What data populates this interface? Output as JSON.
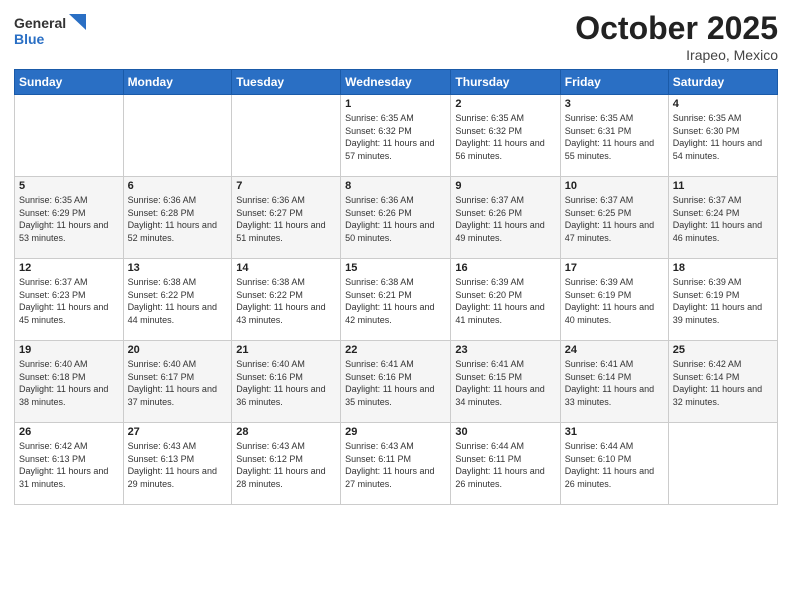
{
  "header": {
    "logo_general": "General",
    "logo_blue": "Blue",
    "month": "October 2025",
    "location": "Irapeo, Mexico"
  },
  "days_of_week": [
    "Sunday",
    "Monday",
    "Tuesday",
    "Wednesday",
    "Thursday",
    "Friday",
    "Saturday"
  ],
  "weeks": [
    [
      {
        "day": "",
        "sunrise": "",
        "sunset": "",
        "daylight": ""
      },
      {
        "day": "",
        "sunrise": "",
        "sunset": "",
        "daylight": ""
      },
      {
        "day": "",
        "sunrise": "",
        "sunset": "",
        "daylight": ""
      },
      {
        "day": "1",
        "sunrise": "Sunrise: 6:35 AM",
        "sunset": "Sunset: 6:32 PM",
        "daylight": "Daylight: 11 hours and 57 minutes."
      },
      {
        "day": "2",
        "sunrise": "Sunrise: 6:35 AM",
        "sunset": "Sunset: 6:32 PM",
        "daylight": "Daylight: 11 hours and 56 minutes."
      },
      {
        "day": "3",
        "sunrise": "Sunrise: 6:35 AM",
        "sunset": "Sunset: 6:31 PM",
        "daylight": "Daylight: 11 hours and 55 minutes."
      },
      {
        "day": "4",
        "sunrise": "Sunrise: 6:35 AM",
        "sunset": "Sunset: 6:30 PM",
        "daylight": "Daylight: 11 hours and 54 minutes."
      }
    ],
    [
      {
        "day": "5",
        "sunrise": "Sunrise: 6:35 AM",
        "sunset": "Sunset: 6:29 PM",
        "daylight": "Daylight: 11 hours and 53 minutes."
      },
      {
        "day": "6",
        "sunrise": "Sunrise: 6:36 AM",
        "sunset": "Sunset: 6:28 PM",
        "daylight": "Daylight: 11 hours and 52 minutes."
      },
      {
        "day": "7",
        "sunrise": "Sunrise: 6:36 AM",
        "sunset": "Sunset: 6:27 PM",
        "daylight": "Daylight: 11 hours and 51 minutes."
      },
      {
        "day": "8",
        "sunrise": "Sunrise: 6:36 AM",
        "sunset": "Sunset: 6:26 PM",
        "daylight": "Daylight: 11 hours and 50 minutes."
      },
      {
        "day": "9",
        "sunrise": "Sunrise: 6:37 AM",
        "sunset": "Sunset: 6:26 PM",
        "daylight": "Daylight: 11 hours and 49 minutes."
      },
      {
        "day": "10",
        "sunrise": "Sunrise: 6:37 AM",
        "sunset": "Sunset: 6:25 PM",
        "daylight": "Daylight: 11 hours and 47 minutes."
      },
      {
        "day": "11",
        "sunrise": "Sunrise: 6:37 AM",
        "sunset": "Sunset: 6:24 PM",
        "daylight": "Daylight: 11 hours and 46 minutes."
      }
    ],
    [
      {
        "day": "12",
        "sunrise": "Sunrise: 6:37 AM",
        "sunset": "Sunset: 6:23 PM",
        "daylight": "Daylight: 11 hours and 45 minutes."
      },
      {
        "day": "13",
        "sunrise": "Sunrise: 6:38 AM",
        "sunset": "Sunset: 6:22 PM",
        "daylight": "Daylight: 11 hours and 44 minutes."
      },
      {
        "day": "14",
        "sunrise": "Sunrise: 6:38 AM",
        "sunset": "Sunset: 6:22 PM",
        "daylight": "Daylight: 11 hours and 43 minutes."
      },
      {
        "day": "15",
        "sunrise": "Sunrise: 6:38 AM",
        "sunset": "Sunset: 6:21 PM",
        "daylight": "Daylight: 11 hours and 42 minutes."
      },
      {
        "day": "16",
        "sunrise": "Sunrise: 6:39 AM",
        "sunset": "Sunset: 6:20 PM",
        "daylight": "Daylight: 11 hours and 41 minutes."
      },
      {
        "day": "17",
        "sunrise": "Sunrise: 6:39 AM",
        "sunset": "Sunset: 6:19 PM",
        "daylight": "Daylight: 11 hours and 40 minutes."
      },
      {
        "day": "18",
        "sunrise": "Sunrise: 6:39 AM",
        "sunset": "Sunset: 6:19 PM",
        "daylight": "Daylight: 11 hours and 39 minutes."
      }
    ],
    [
      {
        "day": "19",
        "sunrise": "Sunrise: 6:40 AM",
        "sunset": "Sunset: 6:18 PM",
        "daylight": "Daylight: 11 hours and 38 minutes."
      },
      {
        "day": "20",
        "sunrise": "Sunrise: 6:40 AM",
        "sunset": "Sunset: 6:17 PM",
        "daylight": "Daylight: 11 hours and 37 minutes."
      },
      {
        "day": "21",
        "sunrise": "Sunrise: 6:40 AM",
        "sunset": "Sunset: 6:16 PM",
        "daylight": "Daylight: 11 hours and 36 minutes."
      },
      {
        "day": "22",
        "sunrise": "Sunrise: 6:41 AM",
        "sunset": "Sunset: 6:16 PM",
        "daylight": "Daylight: 11 hours and 35 minutes."
      },
      {
        "day": "23",
        "sunrise": "Sunrise: 6:41 AM",
        "sunset": "Sunset: 6:15 PM",
        "daylight": "Daylight: 11 hours and 34 minutes."
      },
      {
        "day": "24",
        "sunrise": "Sunrise: 6:41 AM",
        "sunset": "Sunset: 6:14 PM",
        "daylight": "Daylight: 11 hours and 33 minutes."
      },
      {
        "day": "25",
        "sunrise": "Sunrise: 6:42 AM",
        "sunset": "Sunset: 6:14 PM",
        "daylight": "Daylight: 11 hours and 32 minutes."
      }
    ],
    [
      {
        "day": "26",
        "sunrise": "Sunrise: 6:42 AM",
        "sunset": "Sunset: 6:13 PM",
        "daylight": "Daylight: 11 hours and 31 minutes."
      },
      {
        "day": "27",
        "sunrise": "Sunrise: 6:43 AM",
        "sunset": "Sunset: 6:13 PM",
        "daylight": "Daylight: 11 hours and 29 minutes."
      },
      {
        "day": "28",
        "sunrise": "Sunrise: 6:43 AM",
        "sunset": "Sunset: 6:12 PM",
        "daylight": "Daylight: 11 hours and 28 minutes."
      },
      {
        "day": "29",
        "sunrise": "Sunrise: 6:43 AM",
        "sunset": "Sunset: 6:11 PM",
        "daylight": "Daylight: 11 hours and 27 minutes."
      },
      {
        "day": "30",
        "sunrise": "Sunrise: 6:44 AM",
        "sunset": "Sunset: 6:11 PM",
        "daylight": "Daylight: 11 hours and 26 minutes."
      },
      {
        "day": "31",
        "sunrise": "Sunrise: 6:44 AM",
        "sunset": "Sunset: 6:10 PM",
        "daylight": "Daylight: 11 hours and 26 minutes."
      },
      {
        "day": "",
        "sunrise": "",
        "sunset": "",
        "daylight": ""
      }
    ]
  ]
}
